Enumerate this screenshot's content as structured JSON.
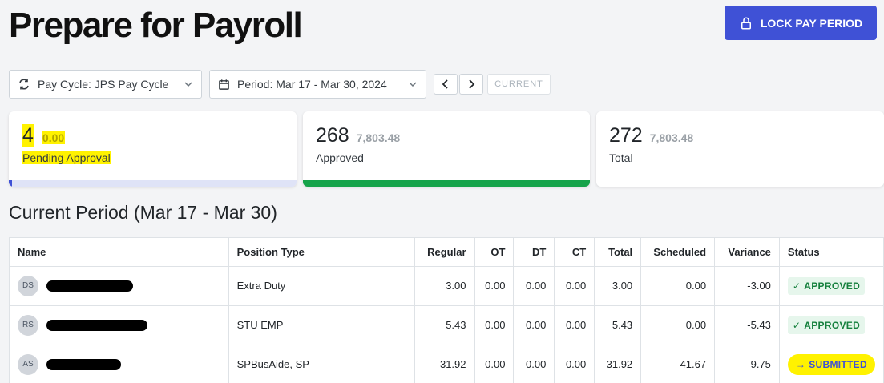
{
  "header": {
    "title": "Prepare for Payroll",
    "lock_button_label": "LOCK PAY PERIOD"
  },
  "filters": {
    "pay_cycle": "Pay Cycle: JPS Pay Cycle",
    "period": "Period: Mar 17 - Mar 30, 2024",
    "current_label": "CURRENT"
  },
  "summary": [
    {
      "count": "4",
      "hours": "0.00",
      "label": "Pending Approval"
    },
    {
      "count": "268",
      "hours": "7,803.48",
      "label": "Approved"
    },
    {
      "count": "272",
      "hours": "7,803.48",
      "label": "Total"
    }
  ],
  "section_title": "Current Period (Mar 17 - Mar 30)",
  "table": {
    "columns": {
      "name": "Name",
      "position": "Position Type",
      "regular": "Regular",
      "ot": "OT",
      "dt": "DT",
      "ct": "CT",
      "total": "Total",
      "scheduled": "Scheduled",
      "variance": "Variance",
      "status": "Status"
    },
    "rows": [
      {
        "initials": "DS",
        "position": "Extra Duty",
        "regular": "3.00",
        "ot": "0.00",
        "dt": "0.00",
        "ct": "0.00",
        "total": "3.00",
        "scheduled": "0.00",
        "variance": "-3.00",
        "status": "APPROVED"
      },
      {
        "initials": "RS",
        "position": "STU EMP",
        "regular": "5.43",
        "ot": "0.00",
        "dt": "0.00",
        "ct": "0.00",
        "total": "5.43",
        "scheduled": "0.00",
        "variance": "-5.43",
        "status": "APPROVED"
      },
      {
        "initials": "AS",
        "position": "SPBusAide, SP",
        "regular": "31.92",
        "ot": "0.00",
        "dt": "0.00",
        "ct": "0.00",
        "total": "31.92",
        "scheduled": "41.67",
        "variance": "9.75",
        "status": "SUBMITTED"
      }
    ]
  },
  "colors": {
    "primary": "#3f51d6",
    "approved_green": "#16a34a",
    "highlight": "#fff200"
  }
}
